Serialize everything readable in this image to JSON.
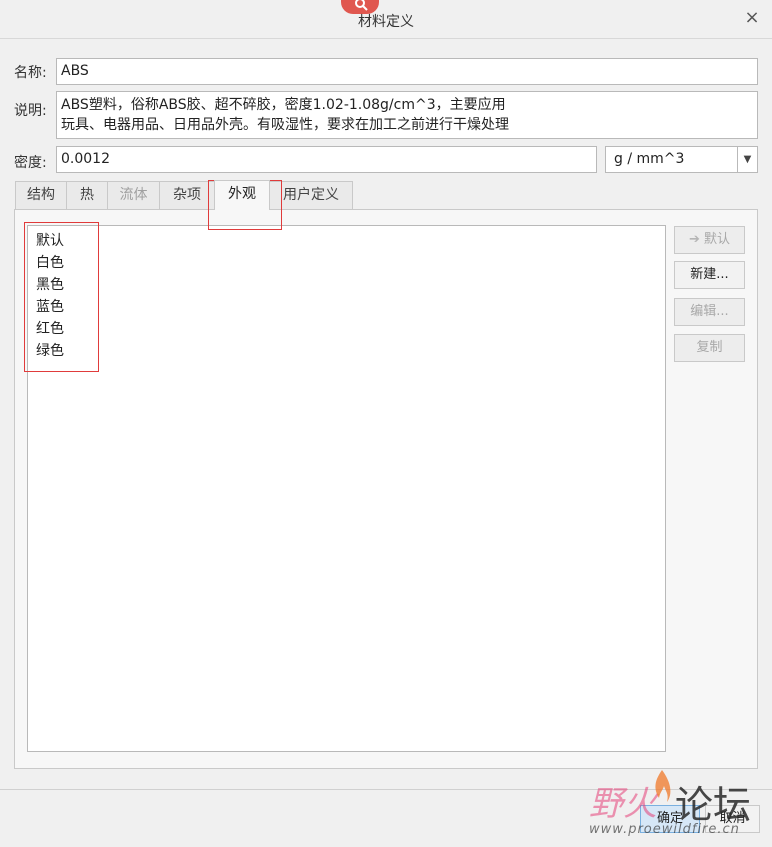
{
  "window": {
    "title": "材料定义",
    "close_symbol": "×"
  },
  "fields": {
    "name_label": "名称:",
    "name_value": "ABS",
    "description_label": "说明:",
    "description_value": "ABS塑料，俗称ABS胶、超不碎胶，密度1.02-1.08g/cm^3，主要应用\n玩具、电器用品、日用品外壳。有吸湿性，要求在加工之前进行干燥处理",
    "density_label": "密度:",
    "density_value": "0.0012",
    "density_unit": "g / mm^3"
  },
  "tabs": [
    {
      "label": "结构",
      "state": "normal"
    },
    {
      "label": "热",
      "state": "normal"
    },
    {
      "label": "流体",
      "state": "disabled"
    },
    {
      "label": "杂项",
      "state": "normal"
    },
    {
      "label": "外观",
      "state": "active"
    },
    {
      "label": "用户定义",
      "state": "normal"
    }
  ],
  "appearance_list": [
    "默认",
    "白色",
    "黑色",
    "蓝色",
    "红色",
    "绿色"
  ],
  "side_buttons": {
    "default": "默认",
    "new": "新建...",
    "edit": "编辑...",
    "copy": "复制"
  },
  "footer": {
    "ok": "确定",
    "cancel": "取消"
  },
  "watermark": {
    "brand_left": "野火",
    "brand_right": "论坛",
    "url": "www.proewildfire.cn"
  },
  "colors": {
    "highlight": "#e03b3b",
    "logo": "#e0574f"
  }
}
